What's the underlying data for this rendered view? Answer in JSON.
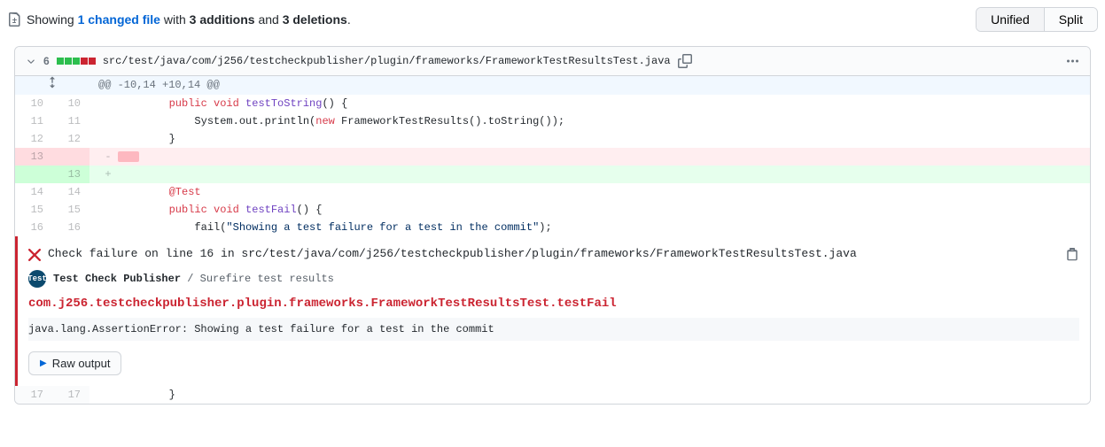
{
  "header": {
    "showing": "Showing",
    "changed_files": "1 changed file",
    "with": "with",
    "additions": "3 additions",
    "and": "and",
    "deletions": "3 deletions",
    "period": ".",
    "unified": "Unified",
    "split": "Split"
  },
  "file": {
    "change_count": "6",
    "path": "src/test/java/com/j256/testcheckpublisher/plugin/frameworks/FrameworkTestResultsTest.java"
  },
  "hunk": "@@ -10,14 +10,14 @@",
  "lines": {
    "l10_old": "10",
    "l10_new": "10",
    "l11_old": "11",
    "l11_new": "11",
    "l12_old": "12",
    "l12_new": "12",
    "l13_old": "13",
    "l13_new": "13",
    "l14_old": "14",
    "l14_new": "14",
    "l15_old": "15",
    "l15_new": "15",
    "l16_old": "16",
    "l16_new": "16",
    "l17_old": "17",
    "l17_new": "17"
  },
  "code": {
    "kw_public": "public",
    "kw_void": "void",
    "fn_testToString": "testToString",
    "fn_testFail": "testFail",
    "sig_open": "() {",
    "sysout": "            System.out.println(",
    "kw_new": "new",
    "sysout_tail": " FrameworkTestResults().toString());",
    "brace_close": "        }",
    "brace_close2": "        }",
    "annotation": "@Test",
    "fail_call": "            fail(",
    "fail_str": "\"Showing a test failure for a test in the commit\"",
    "fail_tail": ");"
  },
  "check": {
    "title": "Check failure on line 16 in src/test/java/com/j256/testcheckpublisher/plugin/frameworks/FrameworkTestResultsTest.java",
    "app_name": "Test Check Publisher",
    "separator": " / ",
    "suite_name": "Surefire test results",
    "fail_title": "com.j256.testcheckpublisher.plugin.frameworks.FrameworkTestResultsTest.testFail",
    "message": "java.lang.AssertionError: Showing a test failure for a test in the commit",
    "raw_output": "Raw output",
    "avatar_label": "Test"
  }
}
